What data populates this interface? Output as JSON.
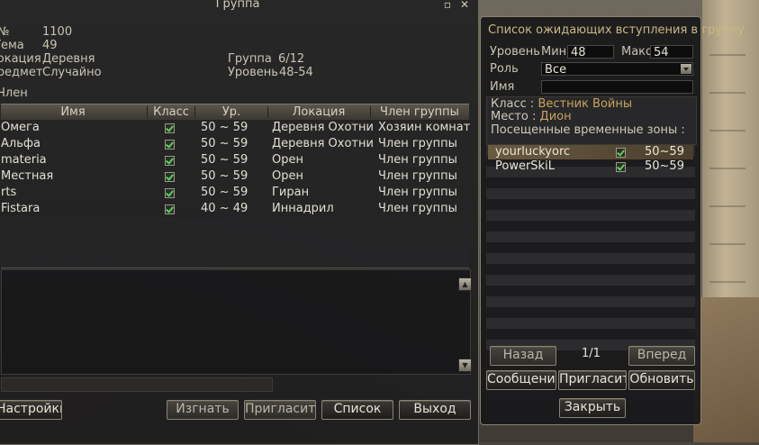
{
  "group_window": {
    "title": "Группа",
    "close_icon": "close-icon",
    "min_icon": "minimize-icon",
    "info": {
      "num_label": "№",
      "num_value": "1100",
      "theme_label": "Тема",
      "theme_value": "49",
      "location_label": "Локация",
      "location_value": "Деревня",
      "loot_label": "Предметы",
      "loot_value": "Случайно",
      "group_label": "Группа",
      "group_value": "6/12",
      "level_label": "Уровень",
      "level_value": "48-54"
    },
    "member_label": "Член",
    "columns": [
      "Имя",
      "Класс",
      "Ур.",
      "Локация",
      "Член группы"
    ],
    "members": [
      {
        "name": "Омега",
        "level": "50 ~ 59",
        "location": "Деревня Охотни",
        "role": "Хозяин комнат"
      },
      {
        "name": "Альфа",
        "level": "50 ~ 59",
        "location": "Деревня Охотни",
        "role": "Член группы"
      },
      {
        "name": "materia",
        "level": "50 ~ 59",
        "location": "Орен",
        "role": "Член группы"
      },
      {
        "name": "Местная",
        "level": "50 ~ 59",
        "location": "Орен",
        "role": "Член группы"
      },
      {
        "name": "rts",
        "level": "50 ~ 59",
        "location": "Гиран",
        "role": "Член группы"
      },
      {
        "name": "Fistara",
        "level": "40 ~ 49",
        "location": "Иннадрил",
        "role": "Член группы"
      }
    ],
    "buttons": {
      "settings": "Настройки",
      "kick": "Изгнать",
      "invite": "Пригласить",
      "list": "Список",
      "exit": "Выход"
    }
  },
  "waiting_window": {
    "title": "Список ожидающих вступления в группу",
    "level_label": "Уровень",
    "min_label": "Мин",
    "min_value": "48",
    "max_label": "Макс",
    "max_value": "54",
    "role_label": "Роль",
    "role_value": "Все",
    "name_label": "Имя",
    "name_value": "",
    "class_label": "Класс :",
    "class_value": "Вестник Войны",
    "place_label": "Место :",
    "place_value": "Дион",
    "zones_label": "Посещенные временные зоны :",
    "entries": [
      {
        "name": "yourluckyorc",
        "level": "50~59",
        "selected": true
      },
      {
        "name": "PowerSkiL",
        "level": "50~59",
        "selected": false
      }
    ],
    "page": "1/1",
    "buttons": {
      "back": "Назад",
      "forward": "Вперед",
      "message": "Сообщение",
      "invite": "Пригласить",
      "refresh": "Обновить",
      "close": "Закрыть"
    }
  }
}
